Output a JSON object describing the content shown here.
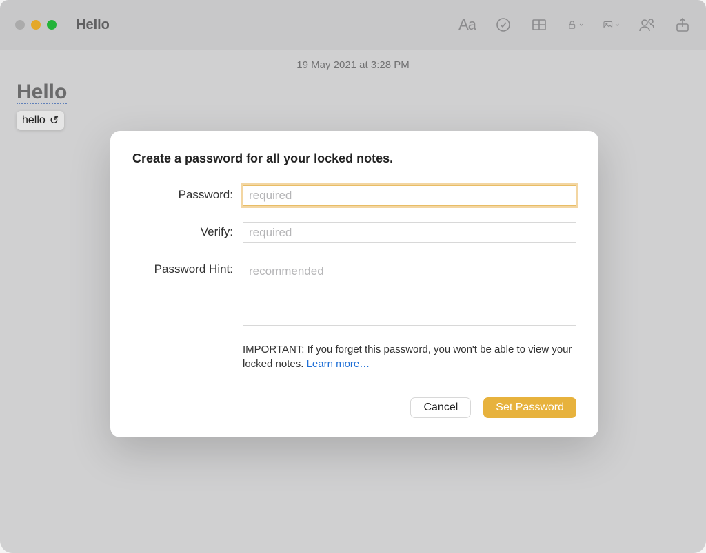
{
  "window": {
    "title": "Hello"
  },
  "note": {
    "timestamp": "19 May 2021 at 3:28 PM",
    "heading": "Hello",
    "suggestion": "hello"
  },
  "dialog": {
    "title": "Create a password for all your locked notes.",
    "labels": {
      "password": "Password:",
      "verify": "Verify:",
      "hint": "Password Hint:"
    },
    "placeholders": {
      "password": "required",
      "verify": "required",
      "hint": "recommended"
    },
    "important_prefix": "IMPORTANT: If you forget this password, you won't be able to view your locked notes. ",
    "learn_more": "Learn more…",
    "buttons": {
      "cancel": "Cancel",
      "set": "Set Password"
    }
  }
}
